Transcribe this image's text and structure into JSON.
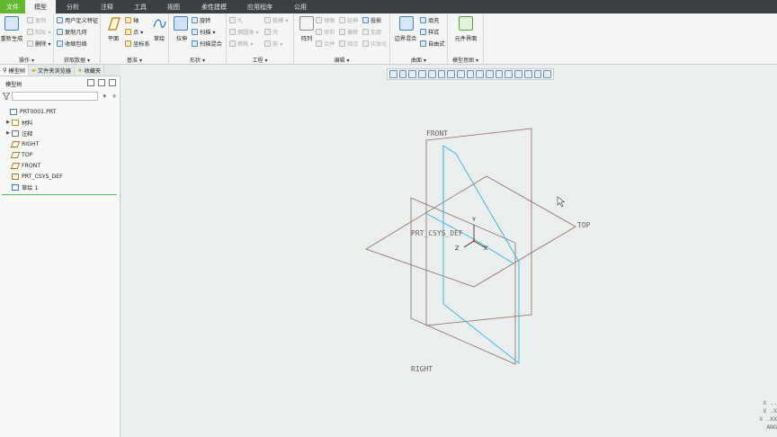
{
  "menubar": {
    "tabs": [
      "文件",
      "模型",
      "分析",
      "注释",
      "工具",
      "视图",
      "柔性建模",
      "应用程序",
      "公用"
    ],
    "active_index": 1
  },
  "ribbon": {
    "groups": {
      "operations": {
        "label": "操作 ▾",
        "regenerate": "重新生成",
        "copy": "复制",
        "paste": "粘贴 ▾",
        "delete": "删除 ▾"
      },
      "get_data": {
        "label": "获取数据 ▾",
        "udf": "用户定义特征",
        "copy_geom": "复制几何",
        "shrinkwrap": "收缩包络"
      },
      "datum": {
        "label": "基准 ▾",
        "plane": "平面",
        "axis": "轴",
        "point": "点 ▾",
        "csys": "坐标系",
        "sketch": "草绘"
      },
      "shapes": {
        "label": "形状 ▾",
        "extrude": "拉伸",
        "revolve": "旋转",
        "sweep": "扫描 ▾",
        "swept_blend": "扫描混合"
      },
      "engineering": {
        "label": "工程 ▾",
        "hole": "孔",
        "round": "倒圆角 ▾",
        "chamfer": "倒角 ▾",
        "draft": "拔模 ▾",
        "shell": "壳",
        "rib": "筋 ▾"
      },
      "editing": {
        "label": "编辑 ▾",
        "pattern": "阵列",
        "mirror": "镜像",
        "extend": "延伸",
        "project": "投影",
        "trim": "修剪",
        "offset": "偏移",
        "thicken": "加厚",
        "merge": "合并",
        "intersect": "相交",
        "solidify": "实体化"
      },
      "surfaces": {
        "label": "曲面 ▾",
        "boundary_blend": "边界混合",
        "fill": "填充",
        "style": "样式",
        "freestyle": "自由式"
      },
      "model_intent": {
        "label": "模型意图 ▾",
        "component_interface": "元件界面"
      }
    }
  },
  "left_panel": {
    "tabs": [
      "模型树",
      "文件夹浏览器",
      "收藏夹"
    ],
    "header": "模型树",
    "search": {
      "value": "",
      "placeholder": ""
    },
    "tree": [
      {
        "label": "PRT0001.PRT",
        "icon": "part-icon",
        "expandable": false,
        "indent": 0
      },
      {
        "label": "材料",
        "icon": "material-icon",
        "expandable": true,
        "indent": 1
      },
      {
        "label": "注释",
        "icon": "annotation-icon",
        "expandable": true,
        "indent": 1
      },
      {
        "label": "RIGHT",
        "icon": "datum-plane-icon",
        "expandable": false,
        "indent": 1
      },
      {
        "label": "TOP",
        "icon": "datum-plane-icon",
        "expandable": false,
        "indent": 1
      },
      {
        "label": "FRONT",
        "icon": "datum-plane-icon",
        "expandable": false,
        "indent": 1
      },
      {
        "label": "PRT_CSYS_DEF",
        "icon": "csys-icon",
        "expandable": false,
        "indent": 1
      },
      {
        "label": "草绘 1",
        "icon": "sketch-icon",
        "expandable": false,
        "indent": 1
      }
    ]
  },
  "graphics": {
    "labels": {
      "front": "FRONT",
      "top": "TOP",
      "right": "RIGHT",
      "csys": "PRT_CSYS_DEF",
      "axis_x": "X",
      "axis_y": "Y",
      "axis_z": "Z"
    },
    "corner_readout": [
      "X ..",
      "X .X",
      "X .XX",
      "ANG"
    ]
  },
  "colors": {
    "menubar": "#3b4045",
    "file_tab": "#63b72f",
    "datum_plane": "#8a6a60",
    "sketch": "#3aaed8",
    "tree_separator": "#5cb85c"
  }
}
